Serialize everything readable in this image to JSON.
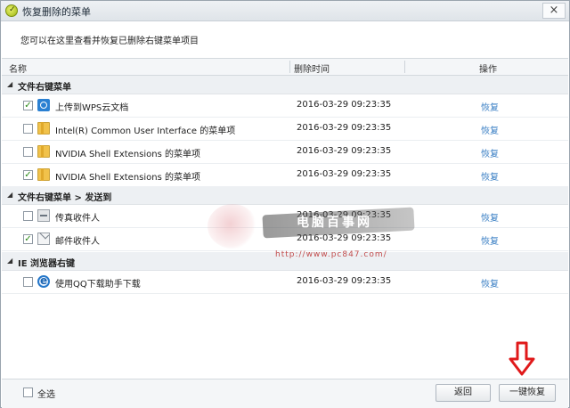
{
  "window": {
    "title": "恢复删除的菜单",
    "close_label": "×"
  },
  "description": "您可以在这里查看并恢复已删除右键菜单项目",
  "columns": {
    "name": "名称",
    "deleted_time": "删除时间",
    "action": "操作"
  },
  "groups": [
    {
      "label": "文件右键菜单",
      "rows": [
        {
          "name": "上传到WPS云文档",
          "time": "2016-03-29 09:23:35",
          "action": "恢复",
          "checked": true,
          "icon": "wps-cloud-icon"
        },
        {
          "name": "Intel(R) Common User Interface 的菜单项",
          "time": "2016-03-29 09:23:35",
          "action": "恢复",
          "checked": false,
          "icon": "folder-icon"
        },
        {
          "name": "NVIDIA Shell Extensions 的菜单项",
          "time": "2016-03-29 09:23:35",
          "action": "恢复",
          "checked": false,
          "icon": "folder-icon"
        },
        {
          "name": "NVIDIA Shell Extensions 的菜单项",
          "time": "2016-03-29 09:23:35",
          "action": "恢复",
          "checked": true,
          "icon": "folder-icon"
        }
      ]
    },
    {
      "label": "文件右键菜单 > 发送到",
      "rows": [
        {
          "name": "传真收件人",
          "time": "2016-03-29 09:23:35",
          "action": "恢复",
          "checked": false,
          "icon": "fax-icon"
        },
        {
          "name": "邮件收件人",
          "time": "2016-03-29 09:23:35",
          "action": "恢复",
          "checked": true,
          "icon": "mail-icon"
        }
      ]
    },
    {
      "label": "IE 浏览器右键",
      "rows": [
        {
          "name": "使用QQ下载助手下载",
          "time": "2016-03-29 09:23:35",
          "action": "恢复",
          "checked": false,
          "icon": "ie-icon"
        }
      ]
    }
  ],
  "watermark": {
    "text": "电脑百事网",
    "url": "http://www.pc847.com/"
  },
  "footer": {
    "select_all": "全选",
    "back": "返回",
    "restore_all": "一键恢复"
  },
  "colors": {
    "link": "#3a7fc4",
    "arrow": "#e0191a",
    "check": "#2b8a17"
  }
}
